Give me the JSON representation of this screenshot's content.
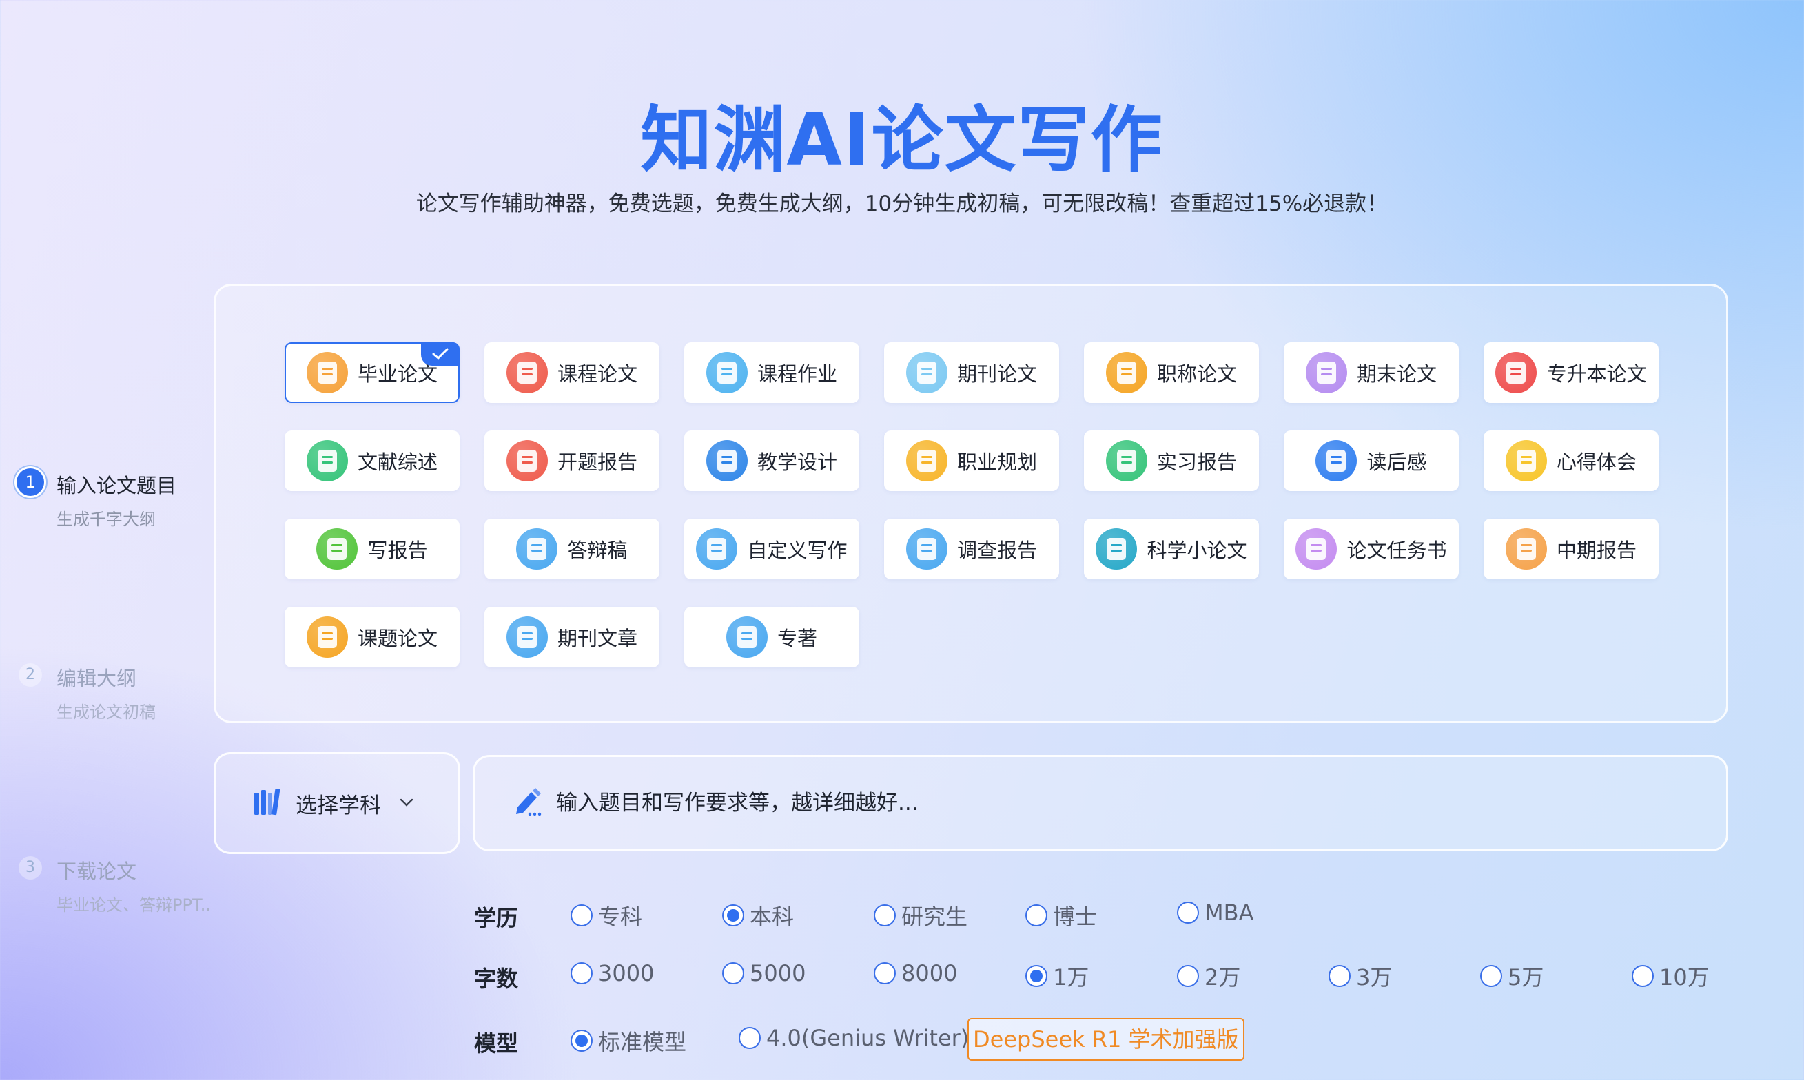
{
  "hero": {
    "title": "知渊AI论文写作",
    "subtitle": "论文写作辅助神器，免费选题，免费生成大纲，10分钟生成初稿，可无限改稿！查重超过15%必退款！"
  },
  "steps": [
    {
      "num": "1",
      "label": "输入论文题目",
      "sub": "生成千字大纲",
      "active": true
    },
    {
      "num": "2",
      "label": "编辑大纲",
      "sub": "生成论文初稿",
      "active": false
    },
    {
      "num": "3",
      "label": "下载论文",
      "sub": "毕业论文、答辩PPT..",
      "active": false
    }
  ],
  "paper_types": [
    {
      "label": "毕业论文",
      "icon": "graduation-cap-icon",
      "color": "#f6a23a",
      "selected": true
    },
    {
      "label": "课程论文",
      "icon": "book-icon",
      "color": "#ef5b4c"
    },
    {
      "label": "课程作业",
      "icon": "list-icon",
      "color": "#4fb3f0"
    },
    {
      "label": "期刊论文",
      "icon": "document-icon",
      "color": "#7cc9f2"
    },
    {
      "label": "职称论文",
      "icon": "certificate-icon",
      "color": "#f5a524"
    },
    {
      "label": "期末论文",
      "icon": "notebook-icon",
      "color": "#b58cf0"
    },
    {
      "label": "专升本论文",
      "icon": "stack-icon",
      "color": "#ee4b4b"
    },
    {
      "label": "文献综述",
      "icon": "open-book-icon",
      "color": "#35c47a"
    },
    {
      "label": "开题报告",
      "icon": "report-icon",
      "color": "#ef5b4c"
    },
    {
      "label": "教学设计",
      "icon": "tools-icon",
      "color": "#2f86e8"
    },
    {
      "label": "职业规划",
      "icon": "tie-icon",
      "color": "#f7b52a"
    },
    {
      "label": "实习报告",
      "icon": "clipboard-icon",
      "color": "#35c47a"
    },
    {
      "label": "读后感",
      "icon": "chat-bubble-icon",
      "color": "#2f7ef0"
    },
    {
      "label": "心得体会",
      "icon": "note-icon",
      "color": "#f7c52a"
    },
    {
      "label": "写报告",
      "icon": "edit-icon",
      "color": "#52c43a"
    },
    {
      "label": "答辩稿",
      "icon": "file-icon",
      "color": "#4aa8f0"
    },
    {
      "label": "自定义写作",
      "icon": "file-icon",
      "color": "#4aa8f0"
    },
    {
      "label": "调查报告",
      "icon": "file-icon",
      "color": "#4aa8f0"
    },
    {
      "label": "科学小论文",
      "icon": "flask-icon",
      "color": "#26a8c8"
    },
    {
      "label": "论文任务书",
      "icon": "task-book-icon",
      "color": "#c48cf0"
    },
    {
      "label": "中期报告",
      "icon": "book-icon",
      "color": "#f5a24a"
    },
    {
      "label": "课题论文",
      "icon": "certificate-icon",
      "color": "#f5a524"
    },
    {
      "label": "期刊文章",
      "icon": "file-icon",
      "color": "#4aa8f0"
    },
    {
      "label": "专著",
      "icon": "file-icon",
      "color": "#4aa8f0"
    }
  ],
  "subject": {
    "label": "选择学科",
    "icon": "books-icon",
    "chevron": "chevron-down-icon"
  },
  "topic": {
    "placeholder": "输入题目和写作要求等，越详细越好...",
    "icon": "pen-icon"
  },
  "options": {
    "education": {
      "title": "学历",
      "items": [
        {
          "label": "专科",
          "on": false
        },
        {
          "label": "本科",
          "on": true
        },
        {
          "label": "研究生",
          "on": false
        },
        {
          "label": "博士",
          "on": false
        },
        {
          "label": "MBA",
          "on": false
        }
      ]
    },
    "words": {
      "title": "字数",
      "items": [
        {
          "label": "3000",
          "on": false
        },
        {
          "label": "5000",
          "on": false
        },
        {
          "label": "8000",
          "on": false
        },
        {
          "label": "1万",
          "on": true
        },
        {
          "label": "2万",
          "on": false
        },
        {
          "label": "3万",
          "on": false
        },
        {
          "label": "5万",
          "on": false
        },
        {
          "label": "10万",
          "on": false
        }
      ]
    },
    "model": {
      "title": "模型",
      "items": [
        {
          "label": "标准模型",
          "on": true
        },
        {
          "label": "4.0(Genius Writer)",
          "on": false
        }
      ],
      "badge": "DeepSeek R1 学术加强版"
    }
  },
  "colors": {
    "accent": "#2f6ff0",
    "badge": "#f08a24"
  }
}
